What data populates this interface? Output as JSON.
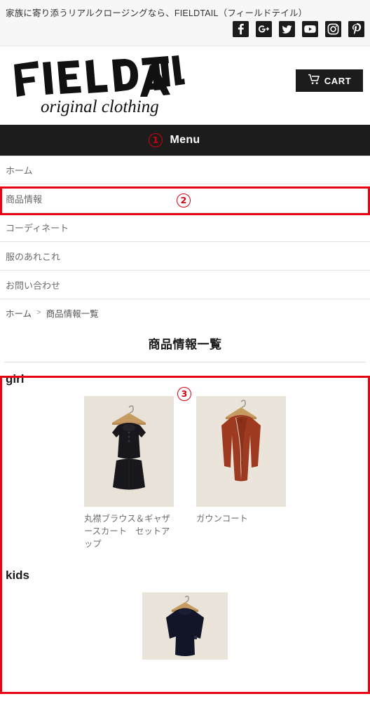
{
  "topbar": {
    "tagline": "家族に寄り添うリアルクロージングなら、FIELDTAIL（フィールドテイル）",
    "socials": [
      {
        "name": "facebook-icon",
        "label": "Facebook"
      },
      {
        "name": "google-plus-icon",
        "label": "Google+"
      },
      {
        "name": "twitter-icon",
        "label": "Twitter"
      },
      {
        "name": "youtube-icon",
        "label": "YouTube"
      },
      {
        "name": "instagram-icon",
        "label": "Instagram"
      },
      {
        "name": "pinterest-icon",
        "label": "Pinterest"
      }
    ]
  },
  "brand": {
    "name": "FIELDTAIL",
    "sub": "original clothing"
  },
  "cart": {
    "label": "CART",
    "icon": "shopping-cart-icon"
  },
  "menubar": {
    "label": "Menu"
  },
  "nav": {
    "items": [
      {
        "label": "ホーム"
      },
      {
        "label": "商品情報"
      },
      {
        "label": "コーディネート"
      },
      {
        "label": "服のあれこれ"
      },
      {
        "label": "お問い合わせ"
      }
    ]
  },
  "breadcrumb": {
    "home": "ホーム",
    "separator": ">",
    "current": "商品情報一覧"
  },
  "page": {
    "title": "商品情報一覧"
  },
  "categories": [
    {
      "heading": "girl",
      "products": [
        {
          "name": "丸襟ブラウス＆ギャザースカート　セットアップ",
          "image": "black-blouse-and-skirt-setup"
        },
        {
          "name": "ガウンコート",
          "image": "rust-red-gown-coat"
        }
      ]
    },
    {
      "heading": "kids",
      "products": [
        {
          "name": "",
          "image": "navy-long-sleeve-top"
        }
      ]
    }
  ],
  "annotations": {
    "markers": [
      {
        "id": "1",
        "glyph": "①",
        "target": "menu-bar"
      },
      {
        "id": "2",
        "glyph": "②",
        "target": "nav-item-product-info"
      },
      {
        "id": "3",
        "glyph": "③",
        "target": "category-girl"
      }
    ],
    "highlight_color": "#e60012"
  }
}
